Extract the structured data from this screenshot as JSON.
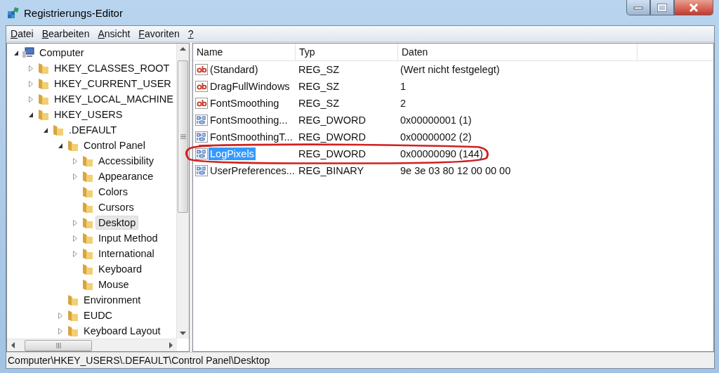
{
  "window": {
    "title": "Registrierungs-Editor"
  },
  "menu": [
    {
      "label": "Datei"
    },
    {
      "label": "Bearbeiten"
    },
    {
      "label": "Ansicht"
    },
    {
      "label": "Favoriten"
    },
    {
      "label": "?"
    }
  ],
  "tree": [
    {
      "label": "Computer",
      "kind": "root",
      "expanded": true,
      "selected": false,
      "children": [
        {
          "label": "HKEY_CLASSES_ROOT",
          "kind": "branch",
          "expanded": false,
          "selected": false
        },
        {
          "label": "HKEY_CURRENT_USER",
          "kind": "branch",
          "expanded": false,
          "selected": false
        },
        {
          "label": "HKEY_LOCAL_MACHINE",
          "kind": "branch",
          "expanded": false,
          "selected": false
        },
        {
          "label": "HKEY_USERS",
          "kind": "branch",
          "expanded": true,
          "selected": false,
          "children": [
            {
              "label": ".DEFAULT",
              "kind": "branch",
              "expanded": true,
              "selected": false,
              "children": [
                {
                  "label": "Control Panel",
                  "kind": "branch",
                  "expanded": true,
                  "selected": false,
                  "children": [
                    {
                      "label": "Accessibility",
                      "kind": "branch",
                      "expanded": false,
                      "selected": false
                    },
                    {
                      "label": "Appearance",
                      "kind": "branch",
                      "expanded": false,
                      "selected": false
                    },
                    {
                      "label": "Colors",
                      "kind": "leaf",
                      "selected": false
                    },
                    {
                      "label": "Cursors",
                      "kind": "leaf",
                      "selected": false
                    },
                    {
                      "label": "Desktop",
                      "kind": "branch",
                      "expanded": false,
                      "selected": true
                    },
                    {
                      "label": "Input Method",
                      "kind": "branch",
                      "expanded": false,
                      "selected": false
                    },
                    {
                      "label": "International",
                      "kind": "branch",
                      "expanded": false,
                      "selected": false
                    },
                    {
                      "label": "Keyboard",
                      "kind": "leaf",
                      "selected": false
                    },
                    {
                      "label": "Mouse",
                      "kind": "leaf",
                      "selected": false
                    }
                  ]
                },
                {
                  "label": "Environment",
                  "kind": "leaf",
                  "selected": false
                },
                {
                  "label": "EUDC",
                  "kind": "branch",
                  "expanded": false,
                  "selected": false
                },
                {
                  "label": "Keyboard Layout",
                  "kind": "branch",
                  "expanded": false,
                  "selected": false
                }
              ]
            }
          ]
        }
      ]
    }
  ],
  "table": {
    "columns": [
      "Name",
      "Typ",
      "Daten"
    ],
    "rows": [
      {
        "kind": "string",
        "name": "(Standard)",
        "type": "REG_SZ",
        "data": "(Wert nicht festgelegt)",
        "selected": false,
        "circled": false
      },
      {
        "kind": "string",
        "name": "DragFullWindows",
        "type": "REG_SZ",
        "data": "1",
        "selected": false,
        "circled": false
      },
      {
        "kind": "string",
        "name": "FontSmoothing",
        "type": "REG_SZ",
        "data": "2",
        "selected": false,
        "circled": false
      },
      {
        "kind": "binary",
        "name": "FontSmoothing...",
        "type": "REG_DWORD",
        "data": "0x00000001 (1)",
        "selected": false,
        "circled": false
      },
      {
        "kind": "binary",
        "name": "FontSmoothingT...",
        "type": "REG_DWORD",
        "data": "0x00000002 (2)",
        "selected": false,
        "circled": false
      },
      {
        "kind": "binary",
        "name": "LogPixels",
        "type": "REG_DWORD",
        "data": "0x00000090 (144)",
        "selected": true,
        "circled": true
      },
      {
        "kind": "binary",
        "name": "UserPreferences...",
        "type": "REG_BINARY",
        "data": "9e 3e 03 80 12 00 00 00",
        "selected": false,
        "circled": false
      }
    ]
  },
  "status_bar": "Computer\\HKEY_USERS\\.DEFAULT\\Control Panel\\Desktop"
}
